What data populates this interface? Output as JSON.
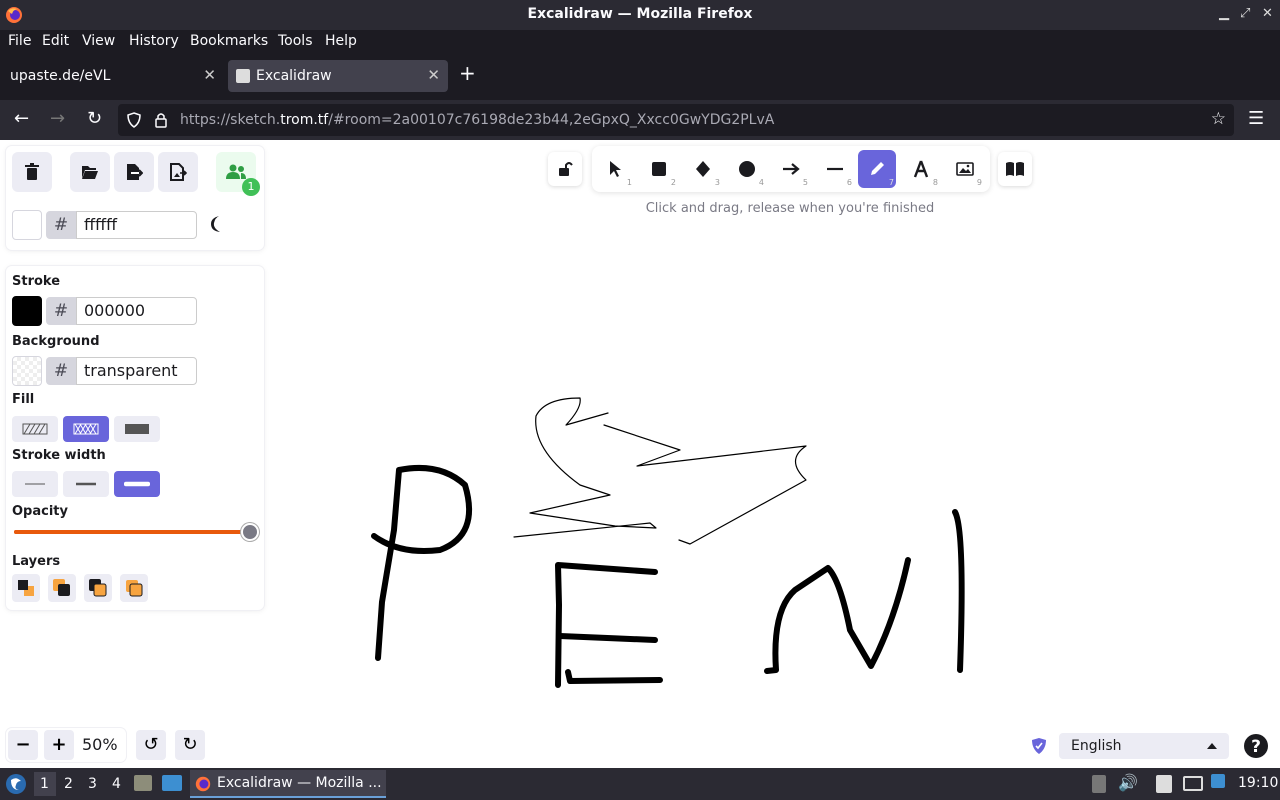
{
  "window": {
    "title": "Excalidraw — Mozilla Firefox"
  },
  "menu": [
    "File",
    "Edit",
    "View",
    "History",
    "Bookmarks",
    "Tools",
    "Help"
  ],
  "tabs": [
    {
      "label": "upaste.de/eVL",
      "active": false
    },
    {
      "label": "Excalidraw",
      "active": true
    }
  ],
  "url": {
    "prefix": "https://sketch.",
    "domain": "trom.tf",
    "rest": "/#room=2a00107c76198de23b44,2eGpxQ_Xxcc0GwYDG2PLvA"
  },
  "topPanel": {
    "collab_badge": "1",
    "canvas_bg_hash": "#",
    "canvas_bg_value": "ffffff"
  },
  "props": {
    "stroke_label": "Stroke",
    "stroke_hash": "#",
    "stroke_value": "000000",
    "background_label": "Background",
    "background_hash": "#",
    "background_value": "transparent",
    "fill_label": "Fill",
    "stroke_width_label": "Stroke width",
    "opacity_label": "Opacity",
    "opacity_level": 1.0,
    "layers_label": "Layers"
  },
  "toolbar": {
    "tools": [
      {
        "name": "selection-tool",
        "num": "1"
      },
      {
        "name": "rectangle-tool",
        "num": "2"
      },
      {
        "name": "diamond-tool",
        "num": "3"
      },
      {
        "name": "ellipse-tool",
        "num": "4"
      },
      {
        "name": "arrow-tool",
        "num": "5"
      },
      {
        "name": "line-tool",
        "num": "6"
      },
      {
        "name": "draw-tool",
        "num": "7",
        "selected": true
      },
      {
        "name": "text-tool",
        "num": "8"
      },
      {
        "name": "image-tool",
        "num": "9"
      }
    ],
    "hint": "Click and drag, release when you're finished"
  },
  "zoom": {
    "value": "50%"
  },
  "language": {
    "selected": "English"
  },
  "taskbar": {
    "workspaces": [
      "1",
      "2",
      "3",
      "4"
    ],
    "window_label": "Excalidraw — Mozilla ...",
    "clock": "19:10"
  },
  "colors": {
    "accent": "#6965db",
    "opacity_track": "#e8590c",
    "chrome_dark": "#2b2a33"
  }
}
